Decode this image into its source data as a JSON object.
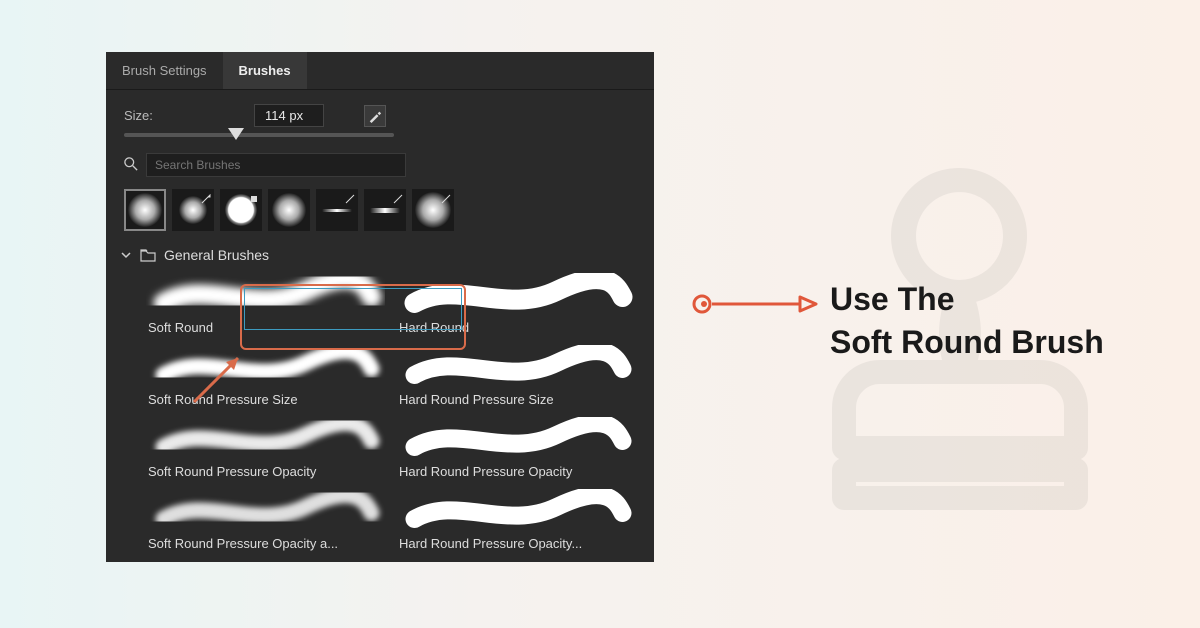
{
  "panel": {
    "tabs": {
      "brush_settings": "Brush Settings",
      "brushes": "Brushes"
    },
    "size_label": "Size:",
    "size_value": "114 px",
    "search_placeholder": "Search Brushes",
    "folder_name": "General Brushes",
    "brushes": [
      {
        "label": "Soft Round",
        "type": "soft"
      },
      {
        "label": "Hard Round",
        "type": "hard"
      },
      {
        "label": "Soft Round Pressure Size",
        "type": "soft"
      },
      {
        "label": "Hard Round Pressure Size",
        "type": "hard"
      },
      {
        "label": "Soft Round Pressure Opacity",
        "type": "soft"
      },
      {
        "label": "Hard Round Pressure Opacity",
        "type": "hard"
      },
      {
        "label": "Soft Round Pressure Opacity a...",
        "type": "soft"
      },
      {
        "label": "Hard Round Pressure Opacity...",
        "type": "hard"
      }
    ]
  },
  "instruction": {
    "line1": "Use The",
    "line2": "Soft Round Brush"
  },
  "colors": {
    "accent": "#d96b4a",
    "select": "#3d9bc0",
    "panel_bg": "#2a2a2a"
  }
}
